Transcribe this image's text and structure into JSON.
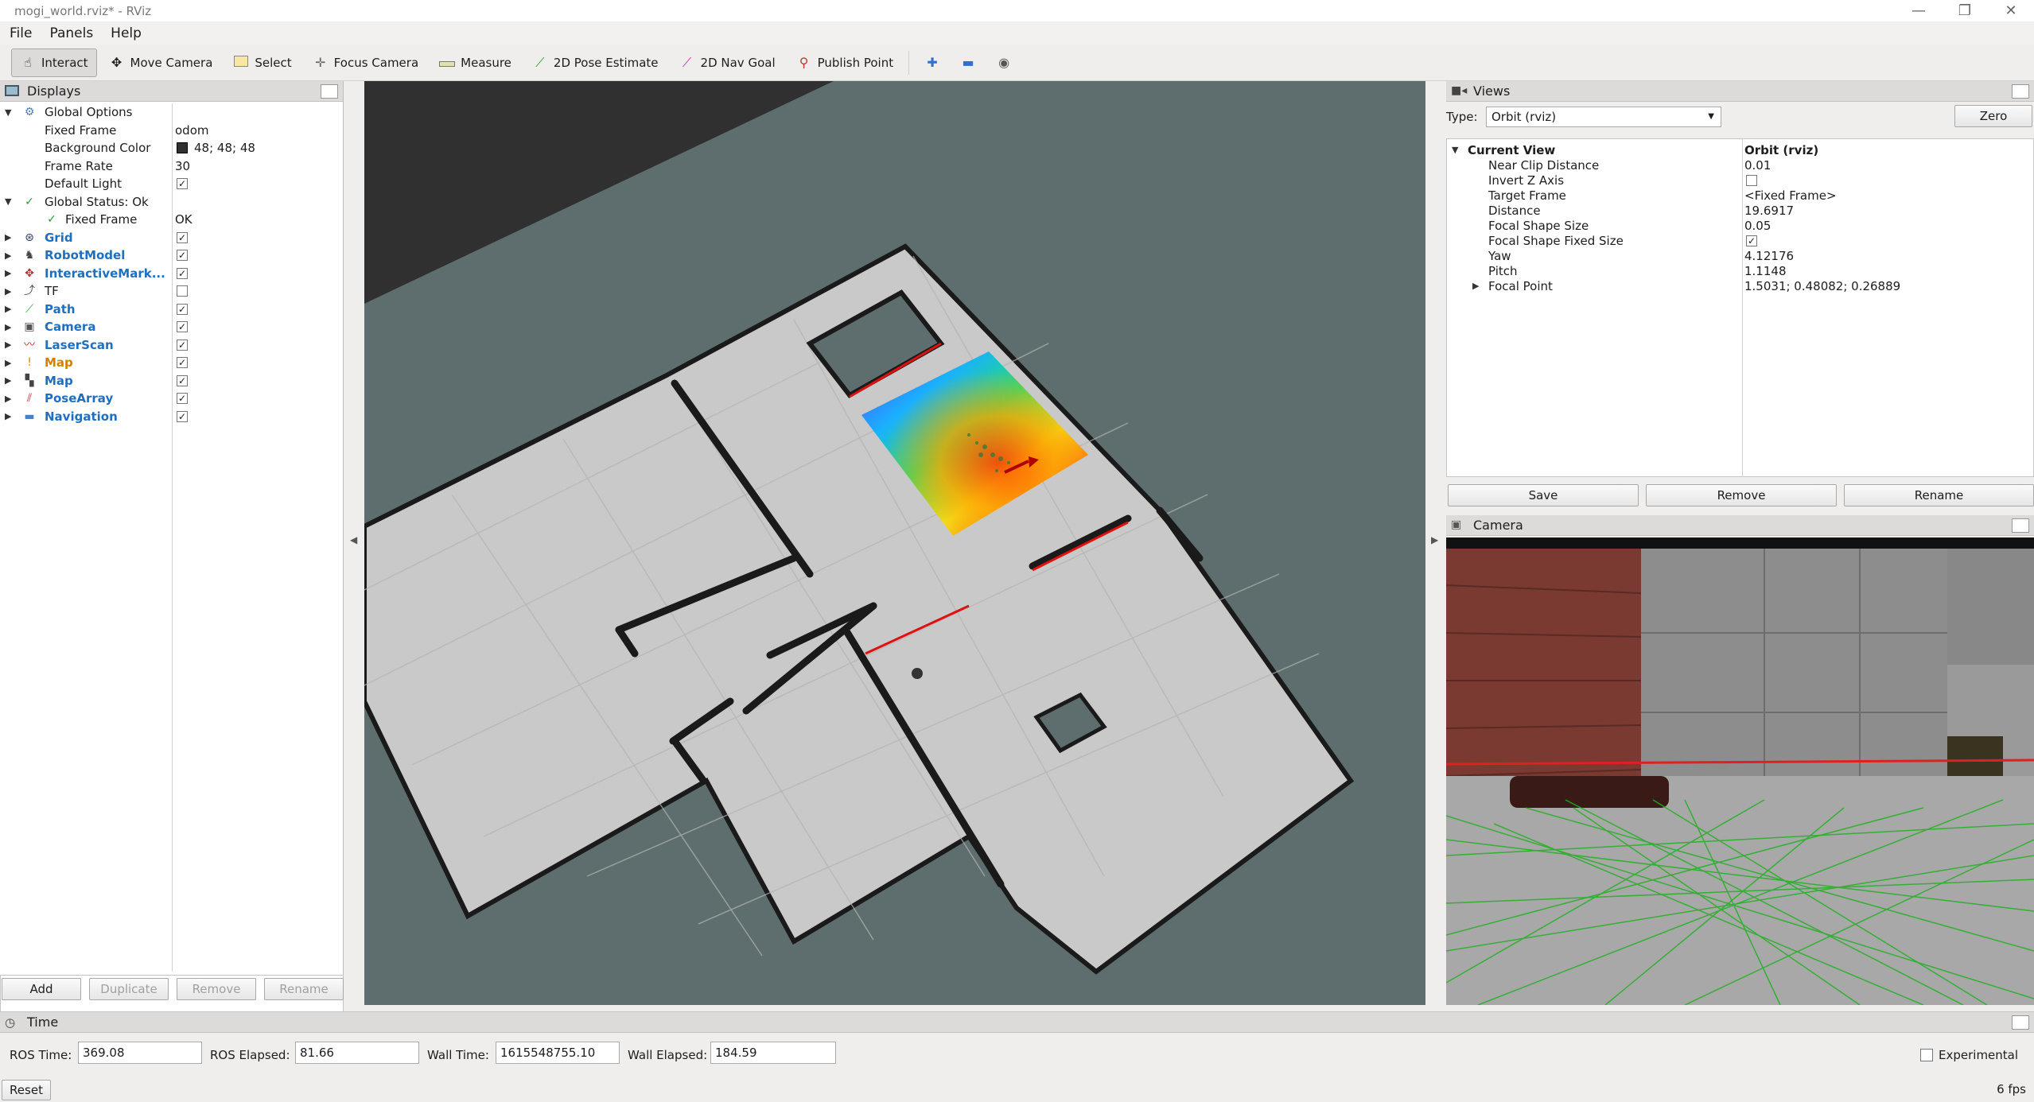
{
  "window": {
    "title": "mogi_world.rviz* - RViz"
  },
  "menu": [
    "File",
    "Panels",
    "Help"
  ],
  "toolbar": {
    "tools": [
      "Interact",
      "Move Camera",
      "Select",
      "Focus Camera",
      "Measure",
      "2D Pose Estimate",
      "2D Nav Goal",
      "Publish Point"
    ],
    "active": "Interact"
  },
  "displays": {
    "title": "Displays",
    "global_options": {
      "label": "Global Options",
      "props": [
        {
          "name": "Fixed Frame",
          "value": "odom"
        },
        {
          "name": "Background Color",
          "value": "48; 48; 48"
        },
        {
          "name": "Frame Rate",
          "value": "30"
        },
        {
          "name": "Default Light",
          "value": "✓"
        }
      ]
    },
    "global_status": {
      "label": "Global Status: Ok",
      "child": "Fixed Frame",
      "child_value": "OK"
    },
    "items": [
      {
        "label": "Grid",
        "checked": "✓",
        "style": "blue",
        "icon": "grid-icon",
        "glyph": "⊛",
        "color": "#2a3a5a"
      },
      {
        "label": "RobotModel",
        "checked": "✓",
        "style": "blue",
        "icon": "robot-model-icon",
        "glyph": "♞",
        "color": "#444"
      },
      {
        "label": "InteractiveMark...",
        "checked": "✓",
        "style": "blue",
        "icon": "interactive-marker-icon",
        "glyph": "✥",
        "color": "#b03030"
      },
      {
        "label": "TF",
        "checked": "",
        "style": "",
        "icon": "tf-icon",
        "glyph": "⤴",
        "color": "#555"
      },
      {
        "label": "Path",
        "checked": "✓",
        "style": "blue",
        "icon": "path-icon",
        "glyph": "⟋",
        "color": "#2fa02f"
      },
      {
        "label": "Camera",
        "checked": "✓",
        "style": "blue",
        "icon": "camera-icon",
        "glyph": "▣",
        "color": "#555"
      },
      {
        "label": "LaserScan",
        "checked": "✓",
        "style": "blue",
        "icon": "laserscan-icon",
        "glyph": "〰",
        "color": "#d02020"
      },
      {
        "label": "Map",
        "checked": "✓",
        "style": "orange",
        "icon": "warning-icon",
        "glyph": "!",
        "color": "#e08400"
      },
      {
        "label": "Map",
        "checked": "✓",
        "style": "blue",
        "icon": "map-icon",
        "glyph": "▚",
        "color": "#444"
      },
      {
        "label": "PoseArray",
        "checked": "✓",
        "style": "blue",
        "icon": "pose-array-icon",
        "glyph": "⫽",
        "color": "#c03030"
      },
      {
        "label": "Navigation",
        "checked": "✓",
        "style": "blue",
        "icon": "folder-icon",
        "glyph": "▬",
        "color": "#4a7fc0"
      }
    ],
    "buttons": [
      "Add",
      "Duplicate",
      "Remove",
      "Rename"
    ]
  },
  "views": {
    "title": "Views",
    "type_label": "Type:",
    "type_value": "Orbit (rviz)",
    "zero": "Zero",
    "current_view": "Current View",
    "current_value": "Orbit (rviz)",
    "props": [
      {
        "name": "Near Clip Distance",
        "value": "0.01"
      },
      {
        "name": "Invert Z Axis",
        "value": ""
      },
      {
        "name": "Target Frame",
        "value": "<Fixed Frame>"
      },
      {
        "name": "Distance",
        "value": "19.6917"
      },
      {
        "name": "Focal Shape Size",
        "value": "0.05"
      },
      {
        "name": "Focal Shape Fixed Size",
        "value": "✓"
      },
      {
        "name": "Yaw",
        "value": "4.12176"
      },
      {
        "name": "Pitch",
        "value": "1.1148"
      },
      {
        "name": "Focal Point",
        "value": "1.5031; 0.48082; 0.26889"
      }
    ],
    "buttons": [
      "Save",
      "Remove",
      "Rename"
    ]
  },
  "camera": {
    "title": "Camera"
  },
  "time": {
    "title": "Time",
    "ros_time_label": "ROS Time:",
    "ros_time": "369.08",
    "ros_elapsed_label": "ROS Elapsed:",
    "ros_elapsed": "81.66",
    "wall_time_label": "Wall Time:",
    "wall_time": "1615548755.10",
    "wall_elapsed_label": "Wall Elapsed:",
    "wall_elapsed": "184.59",
    "experimental": "Experimental",
    "reset": "Reset",
    "fps": "6 fps"
  },
  "colors": {
    "background": "#303030",
    "map_free": "#c9c9c9",
    "map_unknown": "#5e6e6e",
    "accent": "#1e6fbf"
  }
}
